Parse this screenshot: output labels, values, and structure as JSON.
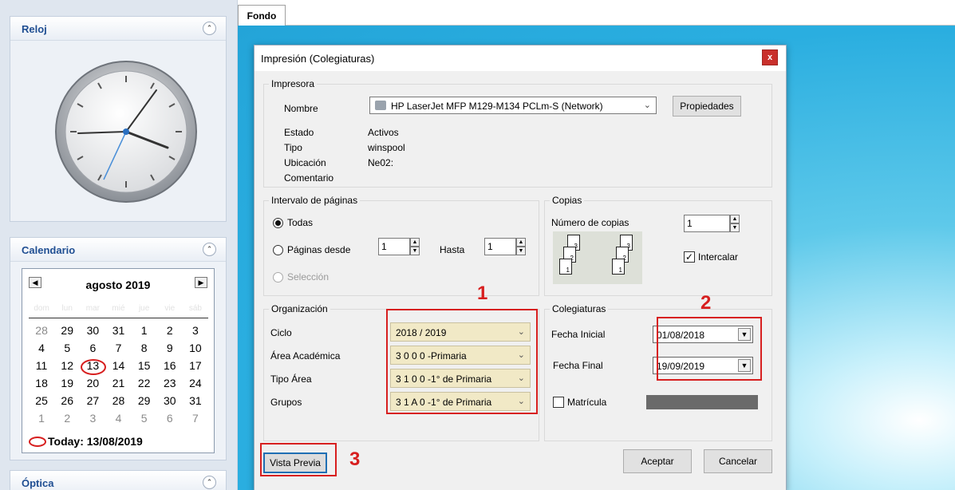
{
  "sidebar": {
    "reloj": {
      "title": "Reloj"
    },
    "calendario": {
      "title": "Calendario",
      "month": "agosto 2019",
      "weekdays": [
        "dom",
        "lun",
        "mar",
        "mié",
        "jue",
        "vie",
        "sáb"
      ],
      "days": [
        {
          "d": "28",
          "other": true
        },
        {
          "d": "29",
          "other": false
        },
        {
          "d": "30",
          "other": false
        },
        {
          "d": "31",
          "other": false
        },
        {
          "d": "1",
          "other": false
        },
        {
          "d": "2",
          "other": false
        },
        {
          "d": "3",
          "other": false
        },
        {
          "d": "4",
          "other": false
        },
        {
          "d": "5",
          "other": false
        },
        {
          "d": "6",
          "other": false
        },
        {
          "d": "7",
          "other": false
        },
        {
          "d": "8",
          "other": false
        },
        {
          "d": "9",
          "other": false
        },
        {
          "d": "10",
          "other": false
        },
        {
          "d": "11",
          "other": false
        },
        {
          "d": "12",
          "other": false
        },
        {
          "d": "13",
          "other": false,
          "today": true
        },
        {
          "d": "14",
          "other": false
        },
        {
          "d": "15",
          "other": false
        },
        {
          "d": "16",
          "other": false
        },
        {
          "d": "17",
          "other": false
        },
        {
          "d": "18",
          "other": false
        },
        {
          "d": "19",
          "other": false
        },
        {
          "d": "20",
          "other": false
        },
        {
          "d": "21",
          "other": false
        },
        {
          "d": "22",
          "other": false
        },
        {
          "d": "23",
          "other": false
        },
        {
          "d": "24",
          "other": false
        },
        {
          "d": "25",
          "other": false
        },
        {
          "d": "26",
          "other": false
        },
        {
          "d": "27",
          "other": false
        },
        {
          "d": "28",
          "other": false
        },
        {
          "d": "29",
          "other": false
        },
        {
          "d": "30",
          "other": false
        },
        {
          "d": "31",
          "other": false
        },
        {
          "d": "1",
          "other": true
        },
        {
          "d": "2",
          "other": true
        },
        {
          "d": "3",
          "other": true
        },
        {
          "d": "4",
          "other": true
        },
        {
          "d": "5",
          "other": true
        },
        {
          "d": "6",
          "other": true
        },
        {
          "d": "7",
          "other": true
        }
      ],
      "today_label": "Today: 13/08/2019"
    },
    "optica": {
      "title": "Óptica"
    }
  },
  "tabs": {
    "fondo": "Fondo"
  },
  "dialog": {
    "title": "Impresión (Colegiaturas)",
    "close": "x",
    "impresora": {
      "group": "Impresora",
      "nombre_label": "Nombre",
      "nombre_value": "HP LaserJet MFP M129-M134 PCLm-S (Network)",
      "propiedades": "Propiedades",
      "estado_label": "Estado",
      "estado_value": "Activos",
      "tipo_label": "Tipo",
      "tipo_value": "winspool",
      "ubicacion_label": "Ubicación",
      "ubicacion_value": "Ne02:",
      "comentario_label": "Comentario"
    },
    "intervalo": {
      "group": "Intervalo de páginas",
      "todas": "Todas",
      "paginas_desde": "Páginas desde",
      "desde_value": "1",
      "hasta": "Hasta",
      "hasta_value": "1",
      "seleccion": "Selección"
    },
    "copias": {
      "group": "Copias",
      "numero_label": "Número de copias",
      "numero_value": "1",
      "intercalar": "Intercalar",
      "intercalar_checked": true
    },
    "organizacion": {
      "group": "Organización",
      "ciclo_label": "Ciclo",
      "ciclo_value": "2018 / 2019",
      "area_label": "Área Académica",
      "area_value": "3 0 0 0 -Primaria",
      "tipo_area_label": "Tipo Área",
      "tipo_area_value": "3 1 0 0 -1° de Primaria",
      "grupos_label": "Grupos",
      "grupos_value": "3 1 A 0 -1° de Primaria"
    },
    "colegiaturas": {
      "group": "Colegiaturas",
      "fecha_inicial_label": "Fecha Inicial",
      "fecha_inicial_value": "01/08/2018",
      "fecha_final_label": "Fecha Final",
      "fecha_final_value": "19/09/2019",
      "matricula": "Matrícula"
    },
    "buttons": {
      "vista_previa": "Vista Previa",
      "aceptar": "Aceptar",
      "cancelar": "Cancelar"
    }
  },
  "annotations": {
    "one": "1",
    "two": "2",
    "three": "3"
  },
  "colors": {
    "annotation": "#d71f1f",
    "accent": "#1f4e92"
  }
}
